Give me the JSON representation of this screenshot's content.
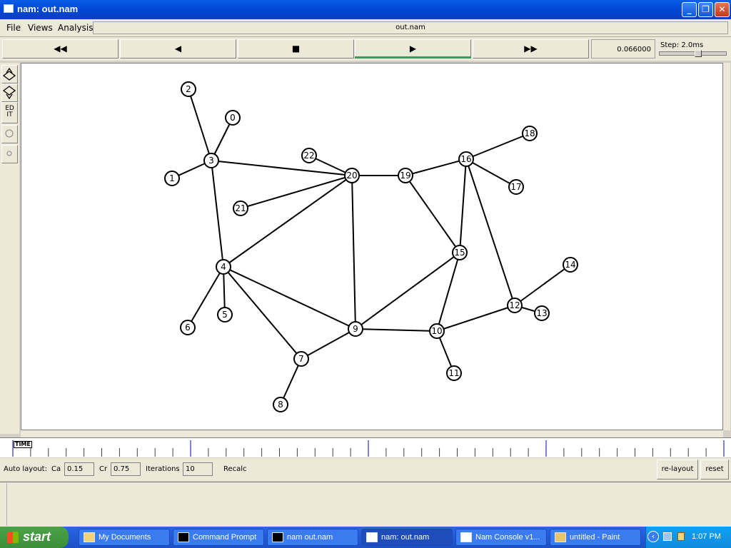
{
  "window": {
    "title": "nam: out.nam"
  },
  "menu": {
    "file": "File",
    "views": "Views",
    "analysis": "Analysis",
    "filename": "out.nam"
  },
  "controls": {
    "rewind": "◀◀",
    "back": "◀",
    "stop": "■",
    "play": "▶",
    "forward": "▶▶",
    "time": "0.066000",
    "step": "Step: 2.0ms"
  },
  "tools": {
    "edit": "ED IT"
  },
  "timeline": {
    "label": "TIME"
  },
  "autolayout": {
    "label": "Auto layout:",
    "ca_label": "Ca",
    "ca_value": "0.15",
    "cr_label": "Cr",
    "cr_value": "0.75",
    "iter_label": "Iterations",
    "iter_value": "10",
    "recalc": "Recalc",
    "relayout": "re-layout",
    "reset": "reset"
  },
  "network": {
    "nodes": [
      {
        "id": "0"
      },
      {
        "id": "1"
      },
      {
        "id": "2"
      },
      {
        "id": "3"
      },
      {
        "id": "4"
      },
      {
        "id": "5"
      },
      {
        "id": "6"
      },
      {
        "id": "7"
      },
      {
        "id": "8"
      },
      {
        "id": "9"
      },
      {
        "id": "10"
      },
      {
        "id": "11"
      },
      {
        "id": "12"
      },
      {
        "id": "13"
      },
      {
        "id": "14"
      },
      {
        "id": "15"
      },
      {
        "id": "16"
      },
      {
        "id": "17"
      },
      {
        "id": "18"
      },
      {
        "id": "19"
      },
      {
        "id": "20"
      },
      {
        "id": "21"
      },
      {
        "id": "22"
      }
    ],
    "links": [
      [
        "2",
        "3"
      ],
      [
        "0",
        "3"
      ],
      [
        "1",
        "3"
      ],
      [
        "3",
        "20"
      ],
      [
        "3",
        "4"
      ],
      [
        "22",
        "20"
      ],
      [
        "21",
        "20"
      ],
      [
        "4",
        "20"
      ],
      [
        "20",
        "19"
      ],
      [
        "20",
        "9"
      ],
      [
        "19",
        "16"
      ],
      [
        "19",
        "15"
      ],
      [
        "16",
        "18"
      ],
      [
        "16",
        "17"
      ],
      [
        "16",
        "15"
      ],
      [
        "16",
        "12"
      ],
      [
        "4",
        "5"
      ],
      [
        "4",
        "6"
      ],
      [
        "4",
        "7"
      ],
      [
        "4",
        "9"
      ],
      [
        "7",
        "8"
      ],
      [
        "7",
        "9"
      ],
      [
        "9",
        "15"
      ],
      [
        "9",
        "10"
      ],
      [
        "15",
        "10"
      ],
      [
        "10",
        "11"
      ],
      [
        "10",
        "12"
      ],
      [
        "12",
        "14"
      ],
      [
        "12",
        "13"
      ]
    ]
  },
  "taskbar": {
    "start": "start",
    "items": [
      "My Documents",
      "Command Prompt",
      "nam out.nam",
      "nam: out.nam",
      "Nam Console v1...",
      "untitled - Paint"
    ],
    "clock": "1:07 PM"
  }
}
